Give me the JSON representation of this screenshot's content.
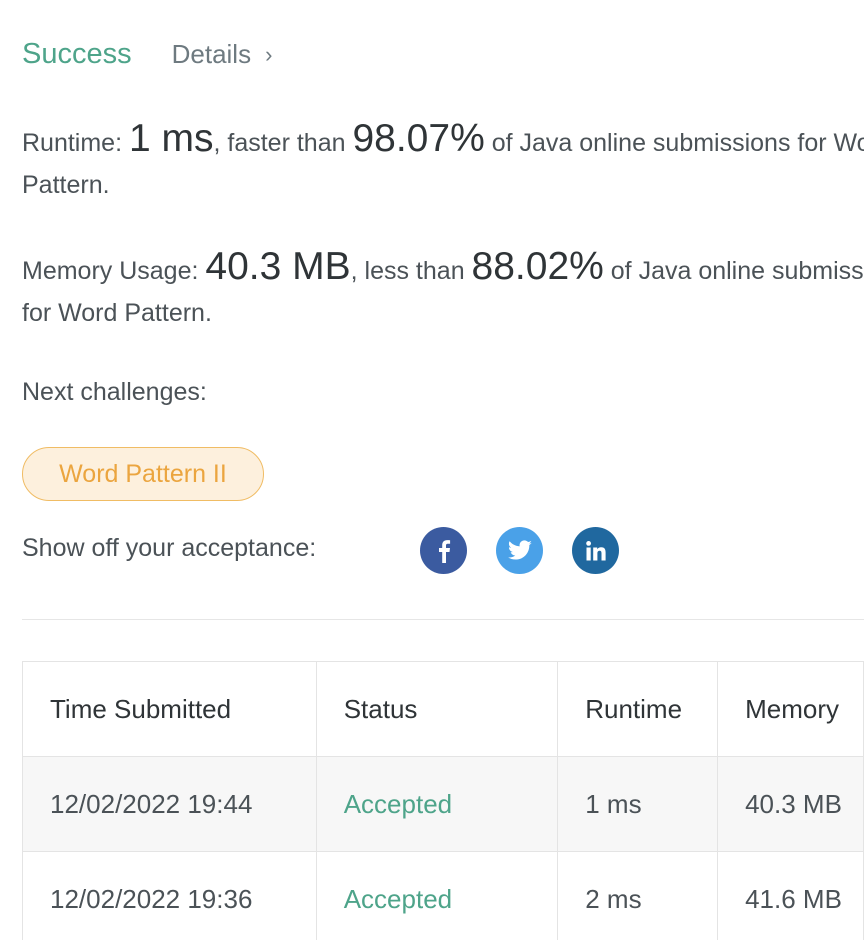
{
  "header": {
    "status": "Success",
    "details_label": "Details",
    "details_chevron": "›"
  },
  "runtime": {
    "label": "Runtime: ",
    "value": "1 ms",
    "mid": ", faster than ",
    "percent": "98.07%",
    "suffix": " of Java online submissions for Word",
    "line2": "Pattern."
  },
  "memory": {
    "label": "Memory Usage: ",
    "value": "40.3 MB",
    "mid": ", less than ",
    "percent": "88.02%",
    "suffix": " of Java online submissions",
    "line2": "for Word Pattern."
  },
  "next": {
    "label": "Next challenges:",
    "challenges": [
      "Word Pattern II"
    ]
  },
  "share": {
    "label": "Show off your acceptance:",
    "icons": [
      "facebook-icon",
      "twitter-icon",
      "linkedin-icon"
    ],
    "colors": {
      "facebook": "#3b5ba0",
      "twitter": "#4aa1e8",
      "linkedin": "#20689f"
    }
  },
  "table": {
    "headers": [
      "Time Submitted",
      "Status",
      "Runtime",
      "Memory"
    ],
    "rows": [
      {
        "time": "12/02/2022 19:44",
        "status": "Accepted",
        "runtime": "1 ms",
        "memory": "40.3 MB"
      },
      {
        "time": "12/02/2022 19:36",
        "status": "Accepted",
        "runtime": "2 ms",
        "memory": "41.6 MB"
      }
    ]
  },
  "colors": {
    "success": "#4ea48a",
    "challenge_chip_text": "#eba53f",
    "challenge_chip_bg": "#fdf0dd"
  }
}
